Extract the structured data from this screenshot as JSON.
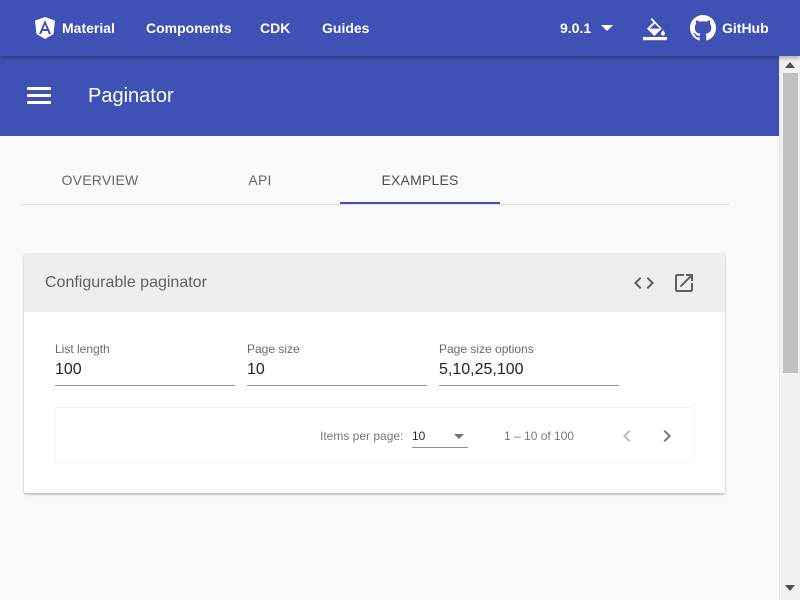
{
  "topnav": {
    "brand": "Material",
    "items": [
      "Components",
      "CDK",
      "Guides"
    ],
    "version": "9.0.1",
    "github": "GitHub"
  },
  "header": {
    "title": "Paginator"
  },
  "tabs": [
    {
      "label": "OVERVIEW",
      "active": false
    },
    {
      "label": "API",
      "active": false
    },
    {
      "label": "EXAMPLES",
      "active": true
    }
  ],
  "example": {
    "title": "Configurable paginator",
    "fields": [
      {
        "label": "List length",
        "value": "100"
      },
      {
        "label": "Page size",
        "value": "10"
      },
      {
        "label": "Page size options",
        "value": "5,10,25,100"
      }
    ],
    "paginator": {
      "items_per_page_label": "Items per page:",
      "page_size": "10",
      "range_label": "1 – 10 of 100",
      "prev_enabled": false,
      "next_enabled": true
    }
  },
  "colors": {
    "primary": "#3f51b5",
    "background": "#fafafa",
    "card_header": "#eeeeee"
  },
  "icons": [
    "angular-logo-icon",
    "arrow-drop-down-icon",
    "format-color-fill-icon",
    "github-icon",
    "menu-icon",
    "code-icon",
    "open-in-new-icon",
    "chevron-left-icon",
    "chevron-right-icon"
  ]
}
